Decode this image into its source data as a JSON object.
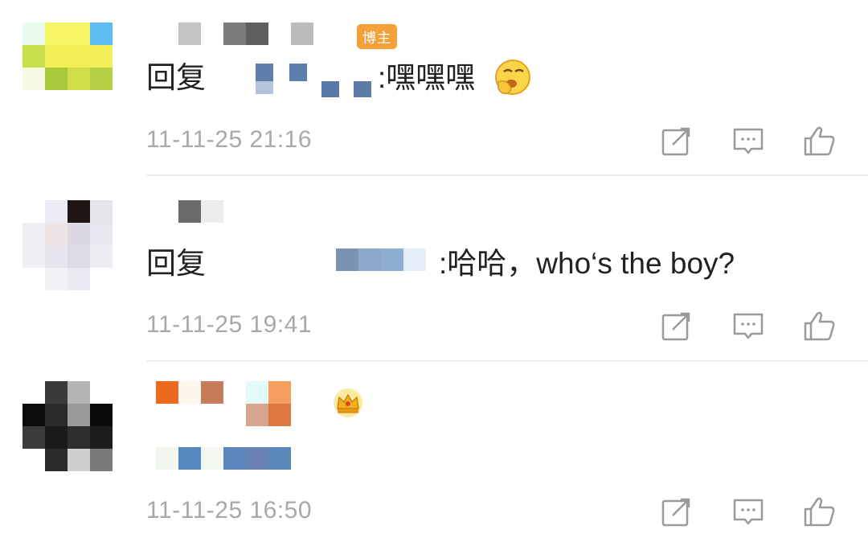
{
  "badge_blogger": "博主",
  "comments": [
    {
      "reply_word": "回复",
      "reply_content": ":嘿嘿嘿",
      "emoji": "yawn-emoji",
      "time": "11-11-25 21:16",
      "actions": [
        "share-icon",
        "comment-icon",
        "like-icon"
      ]
    },
    {
      "reply_word": "回复",
      "reply_content": ":哈哈，who‘s the boy?",
      "time": "11-11-25 19:41",
      "actions": [
        "share-icon",
        "comment-icon",
        "like-icon"
      ]
    },
    {
      "member_icon": "crown-icon",
      "time": "11-11-25 16:50",
      "actions": [
        "share-icon",
        "comment-icon",
        "like-icon"
      ]
    }
  ],
  "colors": {
    "badge": "#f4a13a",
    "time": "#a8a8a8",
    "icon": "#9a9a9a",
    "divider": "#ededed"
  }
}
